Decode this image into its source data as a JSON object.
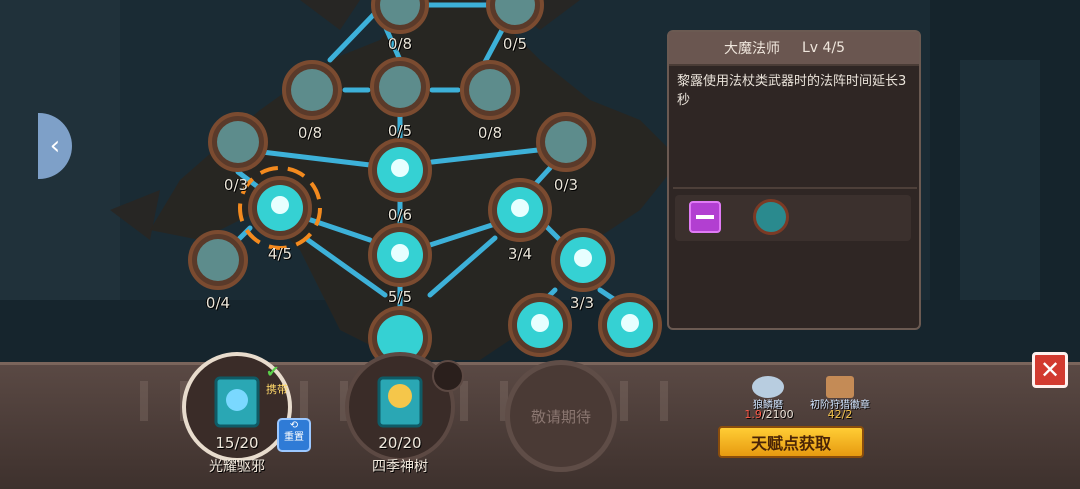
{
  "info_panel": {
    "title": "大魔法师",
    "level": "Lv 4/5",
    "description": "黎露使用法杖类武器时的法阵时间延长3秒"
  },
  "tree_nodes": [
    {
      "id": "top-left",
      "label": ""
    },
    {
      "id": "top-right",
      "label": ""
    },
    {
      "id": "r2-center-label",
      "label": "0/8"
    },
    {
      "id": "r2-right-label",
      "label": "0/5"
    },
    {
      "id": "mid-left",
      "label": "0/8"
    },
    {
      "id": "mid-center",
      "label": "0/5"
    },
    {
      "id": "mid-right",
      "label": "0/8"
    },
    {
      "id": "left-upper",
      "label": "0/3"
    },
    {
      "id": "center",
      "label": "0/6"
    },
    {
      "id": "right-upper",
      "label": "0/3"
    },
    {
      "id": "selected",
      "label": "4/5"
    },
    {
      "id": "right-mid",
      "label": "3/4"
    },
    {
      "id": "left-lower",
      "label": "0/4"
    },
    {
      "id": "center-lower",
      "label": "5/5"
    },
    {
      "id": "right-lower",
      "label": "3/3"
    },
    {
      "id": "bottom-center",
      "label": ""
    },
    {
      "id": "bottom-right-a",
      "label": ""
    },
    {
      "id": "bottom-right-b",
      "label": ""
    }
  ],
  "books": [
    {
      "name": "光耀驱邪",
      "count": "15/20",
      "carry_label": "携带",
      "reset_label": "重置"
    },
    {
      "name": "四季神树",
      "count": "20/20"
    }
  ],
  "coming_soon": "敬请期待",
  "resources": [
    {
      "name": "狼鳞磨",
      "count_current": "1.9",
      "count_max": "/2100"
    },
    {
      "name": "初阶狩猎徽章",
      "count_current": "42",
      "count_max": "/2"
    }
  ],
  "talent_button": "天赋点获取",
  "nav_left": "‹",
  "close_label": "✕"
}
